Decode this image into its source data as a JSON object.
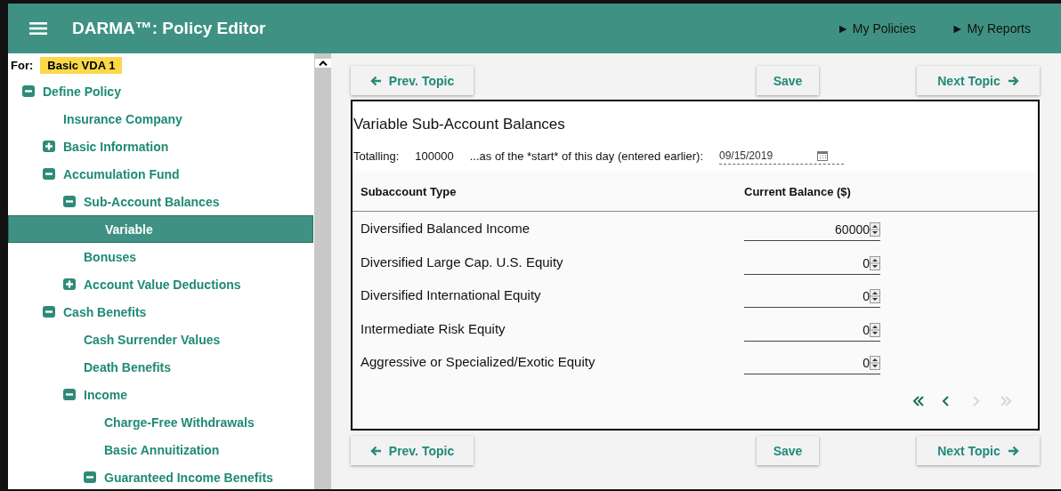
{
  "header": {
    "title": "DARMA™: Policy Editor",
    "links": [
      "► My Policies",
      "► My Reports"
    ]
  },
  "sidebar": {
    "for_label": "For:",
    "policy": "Basic VDA 1",
    "tree": [
      {
        "label": "Define Policy",
        "expanded": true,
        "selected": false,
        "children": [
          {
            "label": "Insurance Company",
            "selected": false
          },
          {
            "label": "Basic Information",
            "expanded": false,
            "selected": false
          },
          {
            "label": "Accumulation Fund",
            "expanded": true,
            "selected": false,
            "children": [
              {
                "label": "Sub-Account Balances",
                "expanded": true,
                "selected": false,
                "children": [
                  {
                    "label": "Variable",
                    "selected": true
                  }
                ]
              },
              {
                "label": "Bonuses",
                "selected": false
              },
              {
                "label": "Account Value Deductions",
                "expanded": false,
                "selected": false
              }
            ]
          },
          {
            "label": "Cash Benefits",
            "expanded": true,
            "selected": false,
            "children": [
              {
                "label": "Cash Surrender Values",
                "selected": false
              },
              {
                "label": "Death Benefits",
                "selected": false
              },
              {
                "label": "Income",
                "expanded": true,
                "selected": false,
                "children": [
                  {
                    "label": "Charge-Free Withdrawals",
                    "selected": false
                  },
                  {
                    "label": "Basic Annuitization",
                    "selected": false
                  },
                  {
                    "label": "Guaranteed Income Benefits",
                    "expanded": true,
                    "selected": false
                  }
                ]
              }
            ]
          }
        ]
      }
    ]
  },
  "nav_top": {
    "prev": "Prev. Topic",
    "save": "Save",
    "next": "Next Topic"
  },
  "panel": {
    "title": "Variable Sub-Account Balances",
    "totalling_label": "Totalling:",
    "total": "100000",
    "date_label": "...as of the *start* of this day (entered earlier):",
    "date": "09/15/2019",
    "table": {
      "columns": [
        "Subaccount Type",
        "Current Balance ($)"
      ],
      "rows": [
        {
          "type": "Diversified Balanced Income",
          "balance": "60000"
        },
        {
          "type": "Diversified Large Cap. U.S. Equity",
          "balance": "0"
        },
        {
          "type": "Diversified International Equity",
          "balance": "0"
        },
        {
          "type": "Intermediate Risk Equity",
          "balance": "0"
        },
        {
          "type": "Aggressive or Specialized/Exotic Equity",
          "balance": "0"
        }
      ]
    },
    "pager": [
      {
        "kind": "first",
        "disabled": false
      },
      {
        "kind": "prev",
        "disabled": false
      },
      {
        "kind": "next",
        "disabled": true
      },
      {
        "kind": "last",
        "disabled": true
      }
    ]
  },
  "nav_bottom": {
    "prev": "Prev. Topic",
    "save": "Save",
    "next": "Next Topic"
  }
}
